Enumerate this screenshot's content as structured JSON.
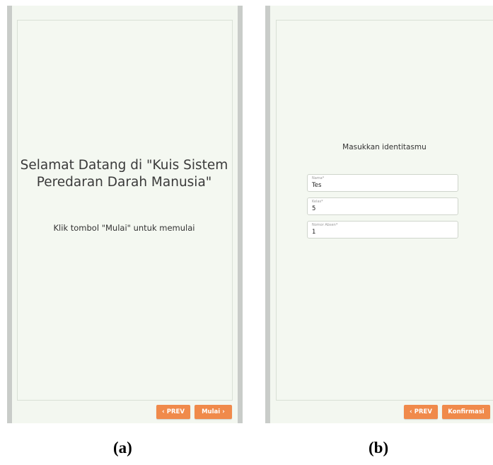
{
  "screen_a": {
    "title": "Selamat Datang di \"Kuis Sistem Peredaran Darah Manusia\"",
    "subtitle": "Klik tombol \"Mulai\" untuk memulai",
    "prev_button": "PREV",
    "start_button": "Mulai"
  },
  "screen_b": {
    "title": "Masukkan identitasmu",
    "fields": [
      {
        "label": "Nama*",
        "value": "Tes"
      },
      {
        "label": "Kelas*",
        "value": "5"
      },
      {
        "label": "Nomor Absen*",
        "value": "1"
      }
    ],
    "prev_button": "PREV",
    "confirm_button": "Konfirmasi"
  },
  "captions": {
    "a": "(a)",
    "b": "(b)"
  },
  "icons": {
    "prev": "chevron-left-icon",
    "next": "chevron-right-icon"
  },
  "colors": {
    "accent": "#f08a4b",
    "screen_bg": "#f3f7f0",
    "side_bar": "#c9ccc9"
  }
}
